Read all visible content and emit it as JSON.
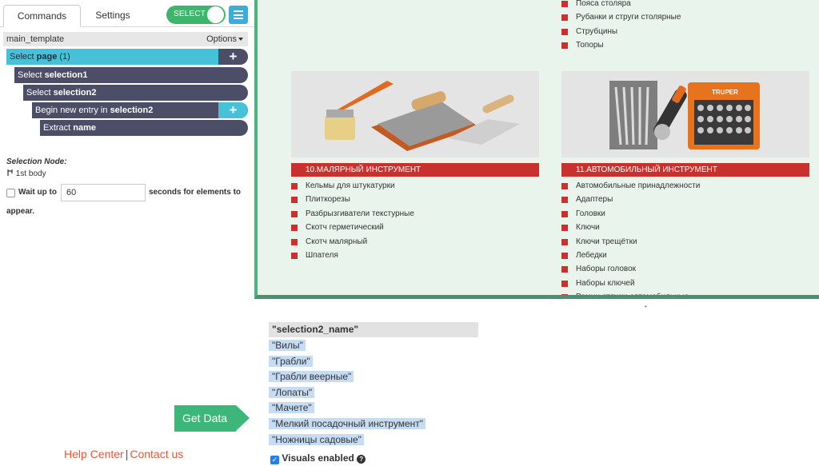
{
  "tabs": {
    "commands": "Commands",
    "settings": "Settings"
  },
  "toggle": {
    "label": "SELECT",
    "state": "on"
  },
  "template": {
    "name": "main_template",
    "options": "Options"
  },
  "commands": [
    {
      "prefix": "Select ",
      "bold": "page",
      "suffix": " (1)"
    },
    {
      "prefix": "Select ",
      "bold": "selection1",
      "suffix": ""
    },
    {
      "prefix": "Select ",
      "bold": "selection2",
      "suffix": ""
    },
    {
      "prefix": "Begin new entry in ",
      "bold": "selection2",
      "suffix": ""
    },
    {
      "prefix": "Extract ",
      "bold": "name",
      "suffix": ""
    }
  ],
  "plus_label": "+",
  "selection_node": {
    "title": "Selection Node:",
    "value": "1st body",
    "icon": "tree-icon"
  },
  "wait": {
    "prefix": "Wait up to",
    "value": "60",
    "suffix": "seconds for elements to",
    "suffix2": "appear."
  },
  "get_data": "Get Data",
  "footer": {
    "help": "Help Center",
    "sep": "|",
    "contact": "Contact us"
  },
  "page": {
    "top_list": [
      "Пояса столяра",
      "Рубанки и струги столярные",
      "Струбцины",
      "Топоры"
    ],
    "cards": [
      {
        "title": "10.МАЛЯРНЫЙ ИНСТРУМЕНТ",
        "items": [
          "Кельмы для штукатурки",
          "Плиткорезы",
          "Разбрызгиватели текстурные",
          "Скотч герметический",
          "Скотч малярный",
          "Шпателя"
        ]
      },
      {
        "title": "11.АВТОМОБИЛЬНЫЙ ИНСТРУМЕНТ",
        "brand": "TRUPER",
        "items": [
          "Автомобильные принадлежности",
          "Адаптеры",
          "Головки",
          "Ключи",
          "Ключи трещётки",
          "Лебедки",
          "Наборы головок",
          "Наборы ключей",
          "Ремни-стяжки автомобильные"
        ]
      }
    ]
  },
  "output": {
    "column": "\"selection2_name\"",
    "rows": [
      "\"Вилы\"",
      "\"Грабли\"",
      "\"Грабли веерные\"",
      "\"Лопаты\"",
      "\"Мачете\"",
      "\"Мелкий посадочный инструмент\"",
      "\"Ножницы садовые\""
    ],
    "visuals_label": "Visuals enabled",
    "visuals_checked": true
  },
  "colors": {
    "accent_green": "#3db56d",
    "accent_cyan": "#47c1d8",
    "command_dark": "#4c4e68",
    "category_red": "#c8312e",
    "link_orange": "#e8593b"
  }
}
